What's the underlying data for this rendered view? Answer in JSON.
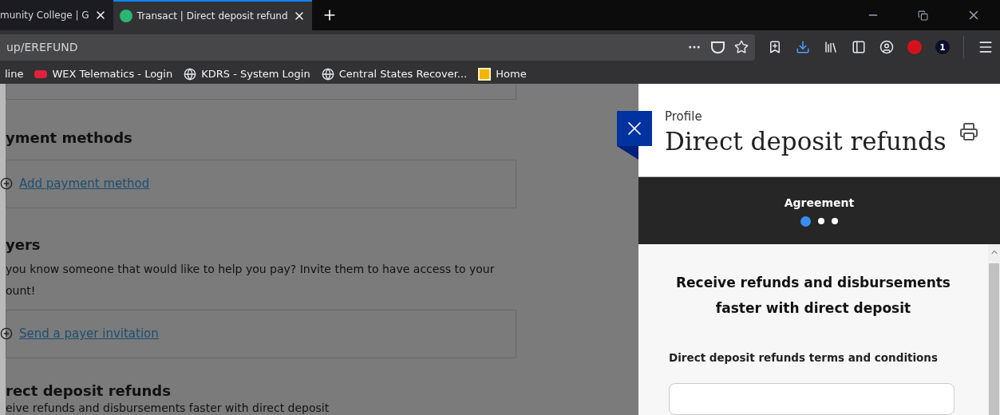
{
  "browser": {
    "tabs": [
      {
        "title": "munity College | G",
        "selected": false
      },
      {
        "title": "Transact | Direct deposit refund",
        "selected": true
      }
    ],
    "url": "up/EREFUND",
    "bookmarks": [
      {
        "kind": "text",
        "label": "line"
      },
      {
        "kind": "wex",
        "label": "WEX Telematics - Login"
      },
      {
        "kind": "globe",
        "label": "KDRS - System Login"
      },
      {
        "kind": "globe",
        "label": "Central States Recover..."
      },
      {
        "kind": "home",
        "label": "Home"
      }
    ],
    "extension_badge": "1"
  },
  "page": {
    "sections": [
      {
        "heading": "yment methods",
        "link": "Add payment method"
      },
      {
        "heading": "yers",
        "text": "you know someone that would like to help you pay? Invite them to have access to your",
        "text2": "ount!",
        "link": "Send a payer invitation"
      },
      {
        "heading": "rect deposit refunds",
        "text": "eive refunds and disbursements faster with direct deposit"
      }
    ]
  },
  "panel": {
    "breadcrumb": "Profile",
    "title": "Direct deposit refunds",
    "steps": [
      {
        "selected": true
      },
      {
        "selected": false
      },
      {
        "selected": false
      }
    ],
    "step_label": "Agreement",
    "intro": "Receive refunds and disbursements faster with direct deposit",
    "terms_heading": "Direct deposit refunds terms and conditions"
  }
}
